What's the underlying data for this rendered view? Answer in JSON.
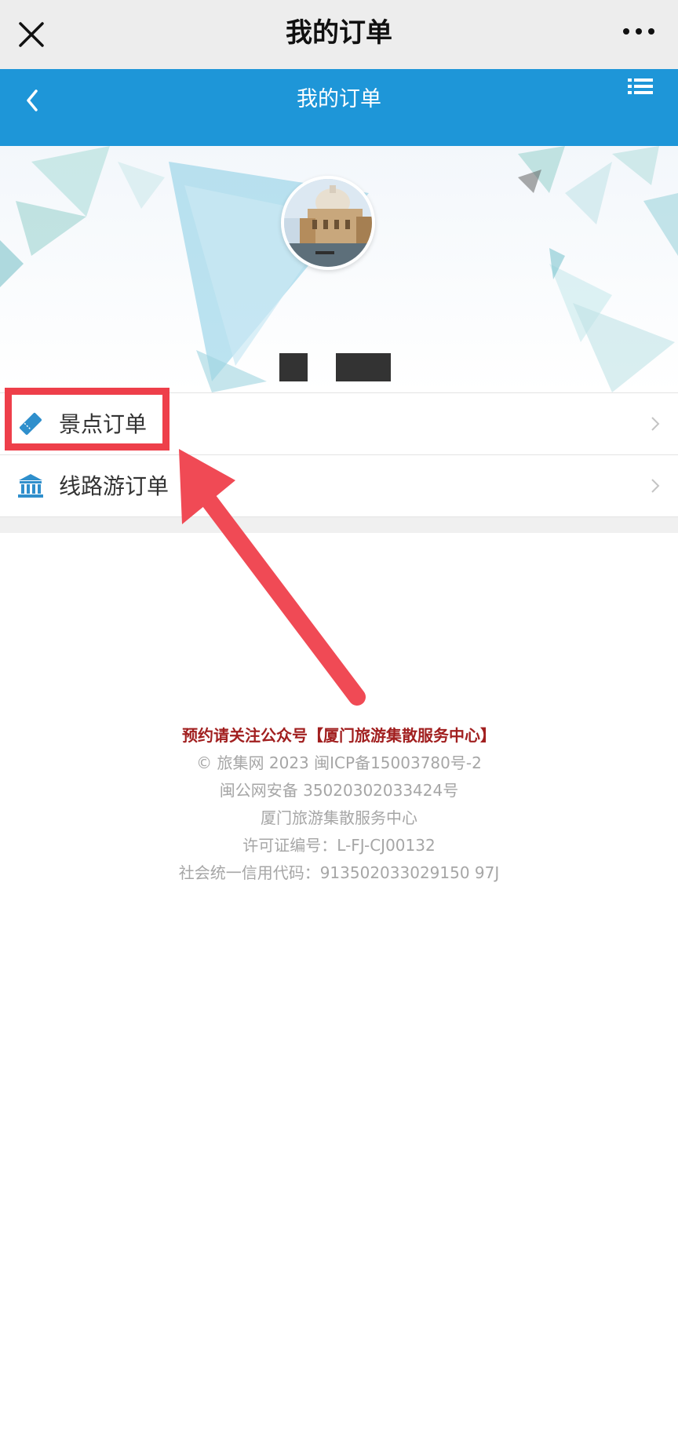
{
  "wechat_bar": {
    "title": "我的订单"
  },
  "app_header": {
    "title": "我的订单"
  },
  "menu": {
    "items": [
      {
        "label": "景点订单",
        "icon": "ticket-icon"
      },
      {
        "label": "线路游订单",
        "icon": "bank-building-icon"
      }
    ]
  },
  "footer": {
    "notice": "预约请关注公众号【厦门旅游集散服务中心】",
    "copyright": "© 旅集网 2023 闽ICP备15003780号-2",
    "police_record": "闽公网安备 35020302033424号",
    "org_name": "厦门旅游集散服务中心",
    "license": "许可证编号：L-FJ-CJ00132",
    "credit_code": "社会统一信用代码：913502033029150 97J"
  },
  "colors": {
    "wechat_bar_bg": "#ededed",
    "header_blue": "#1e96d8",
    "highlight_red": "#ee3f4a",
    "notice_red": "#a11f1f",
    "footer_gray": "#a6a6a6"
  }
}
